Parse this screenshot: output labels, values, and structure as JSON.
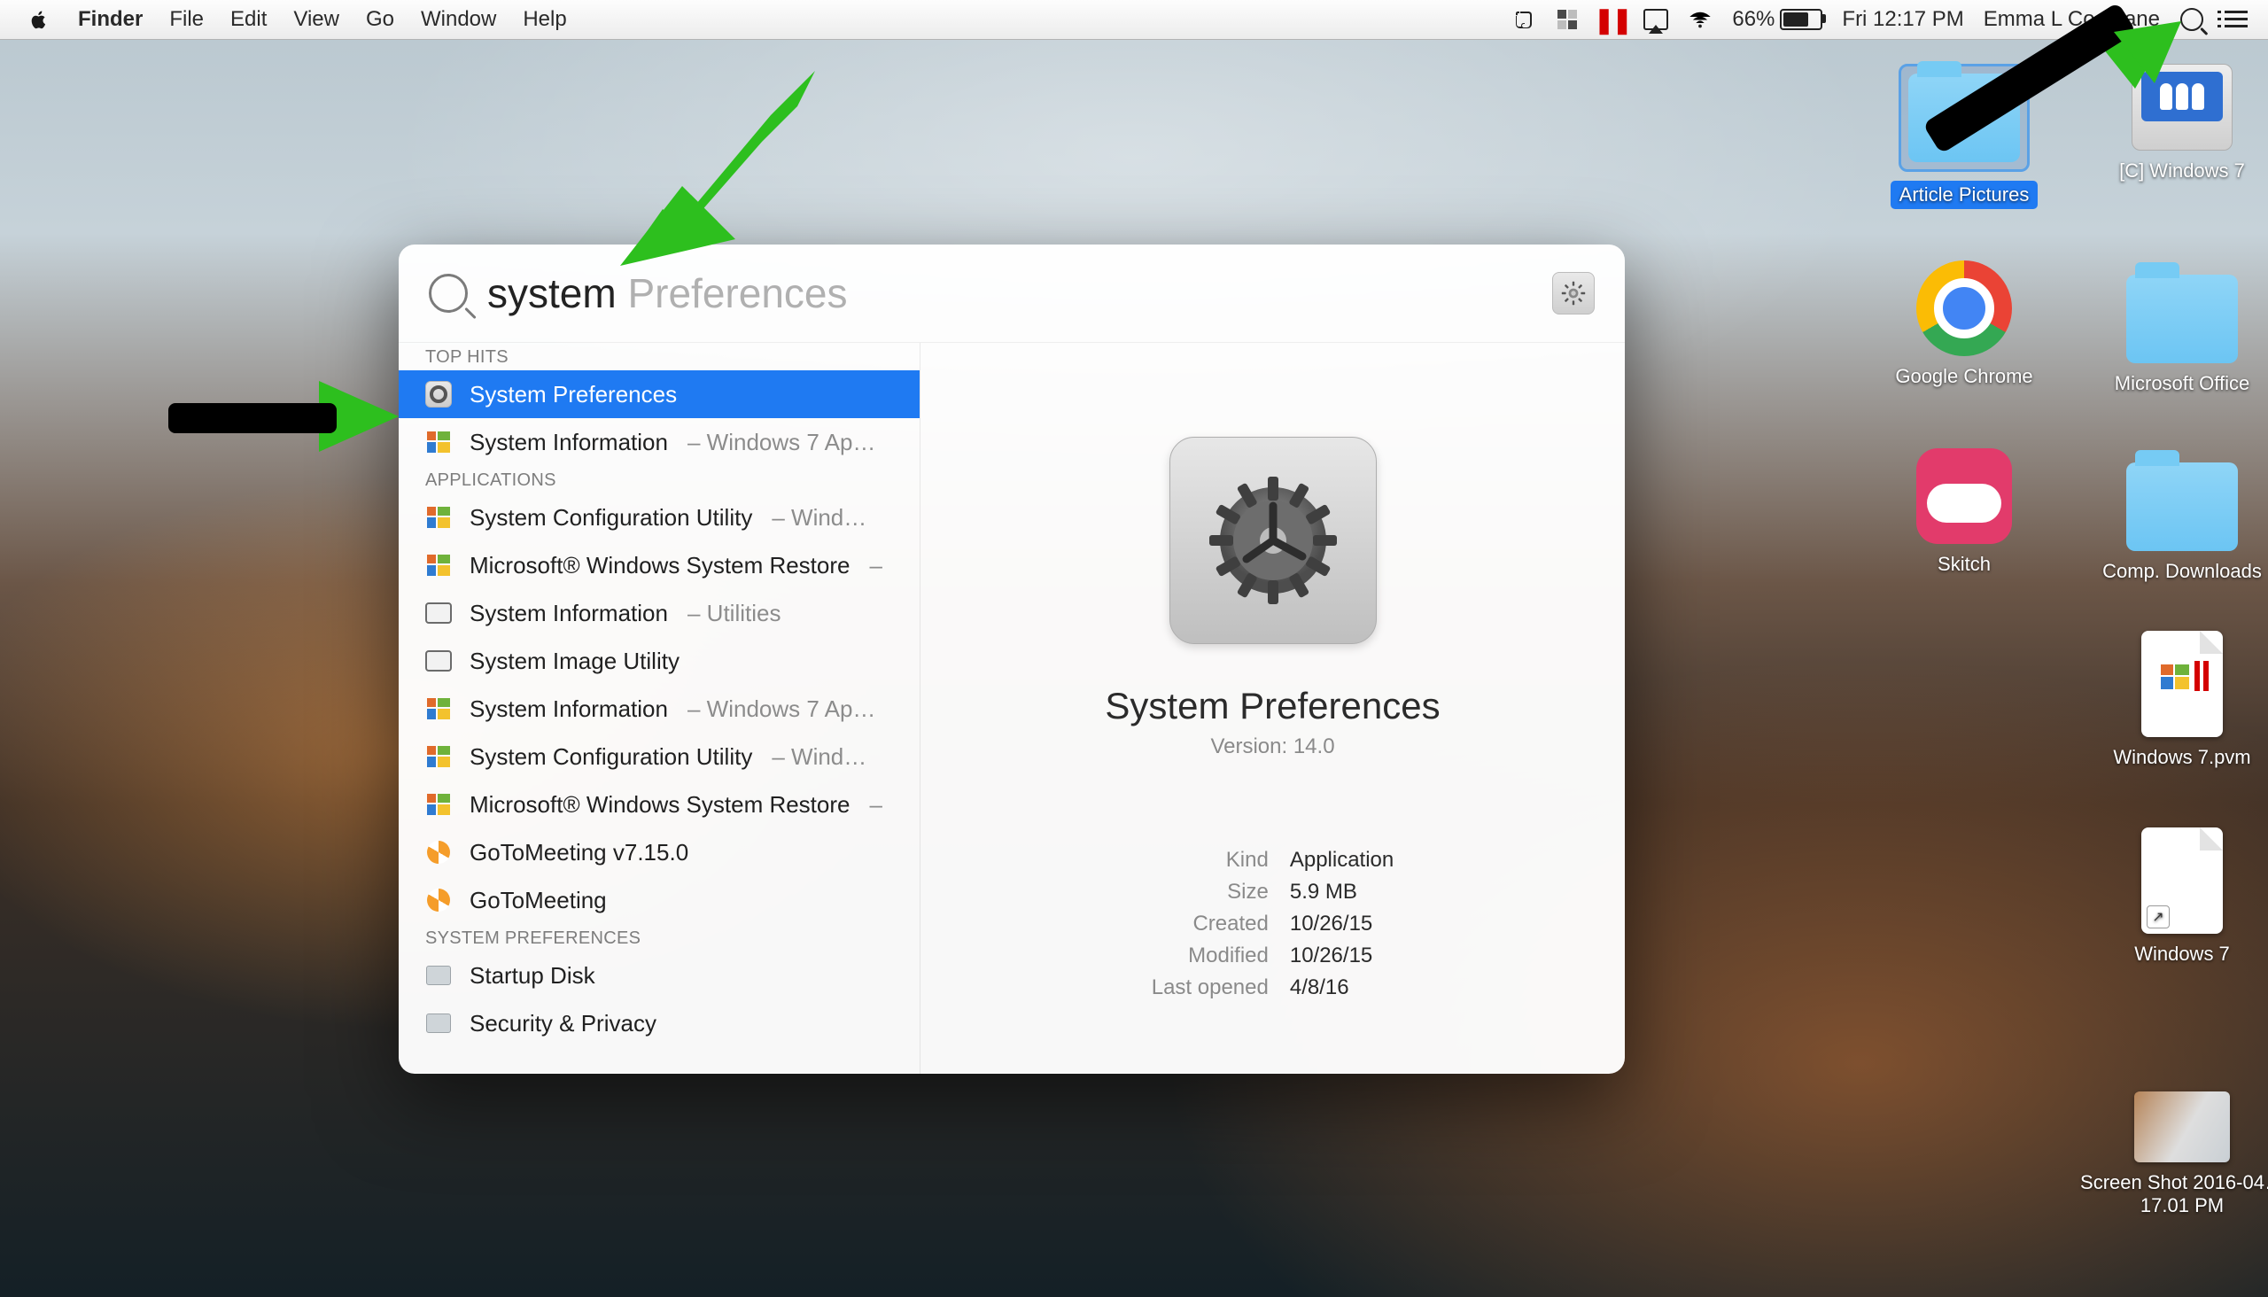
{
  "menubar": {
    "app": "Finder",
    "items": [
      "File",
      "Edit",
      "View",
      "Go",
      "Window",
      "Help"
    ],
    "battery_pct": "66%",
    "datetime": "Fri 12:17 PM",
    "user": "Emma L Cochrane"
  },
  "spotlight": {
    "typed": "system",
    "completion": " Preferences",
    "sections": [
      {
        "title": "TOP HITS",
        "rows": [
          {
            "icon": "prefs",
            "label": "System Preferences",
            "source": "",
            "selected": true
          },
          {
            "icon": "win",
            "label": "System Information",
            "source": "Windows 7 Ap…"
          }
        ]
      },
      {
        "title": "APPLICATIONS",
        "rows": [
          {
            "icon": "win",
            "label": "System Configuration Utility",
            "source": "Wind…"
          },
          {
            "icon": "win",
            "label": "Microsoft® Windows System Restore",
            "source": ""
          },
          {
            "icon": "term",
            "label": "System Information",
            "source": "Utilities"
          },
          {
            "icon": "term",
            "label": "System Image Utility",
            "source": ""
          },
          {
            "icon": "win",
            "label": "System Information",
            "source": "Windows 7 Ap…"
          },
          {
            "icon": "win",
            "label": "System Configuration Utility",
            "source": "Wind…"
          },
          {
            "icon": "win",
            "label": "Microsoft® Windows System Restore",
            "source": ""
          },
          {
            "icon": "gtm",
            "label": "GoToMeeting v7.15.0",
            "source": ""
          },
          {
            "icon": "gtm",
            "label": "GoToMeeting",
            "source": ""
          }
        ]
      },
      {
        "title": "SYSTEM PREFERENCES",
        "rows": [
          {
            "icon": "disk",
            "label": "Startup Disk",
            "source": ""
          },
          {
            "icon": "disk",
            "label": "Security & Privacy",
            "source": ""
          }
        ]
      }
    ],
    "preview": {
      "title": "System Preferences",
      "version": "Version: 14.0",
      "meta": [
        {
          "k": "Kind",
          "v": "Application"
        },
        {
          "k": "Size",
          "v": "5.9 MB"
        },
        {
          "k": "Created",
          "v": "10/26/15"
        },
        {
          "k": "Modified",
          "v": "10/26/15"
        },
        {
          "k": "Last opened",
          "v": "4/8/16"
        }
      ]
    }
  },
  "desktop_icons": {
    "article_pictures": "Article Pictures",
    "windows7_disk": "[C] Windows 7",
    "chrome": "Google Chrome",
    "ms_office": "Microsoft Office",
    "skitch": "Skitch",
    "comp_downloads": "Comp. Downloads",
    "win7_pvm": "Windows 7.pvm",
    "win7_shortcut": "Windows 7",
    "screenshot": "Screen Shot 2016-04…17.01 PM"
  }
}
